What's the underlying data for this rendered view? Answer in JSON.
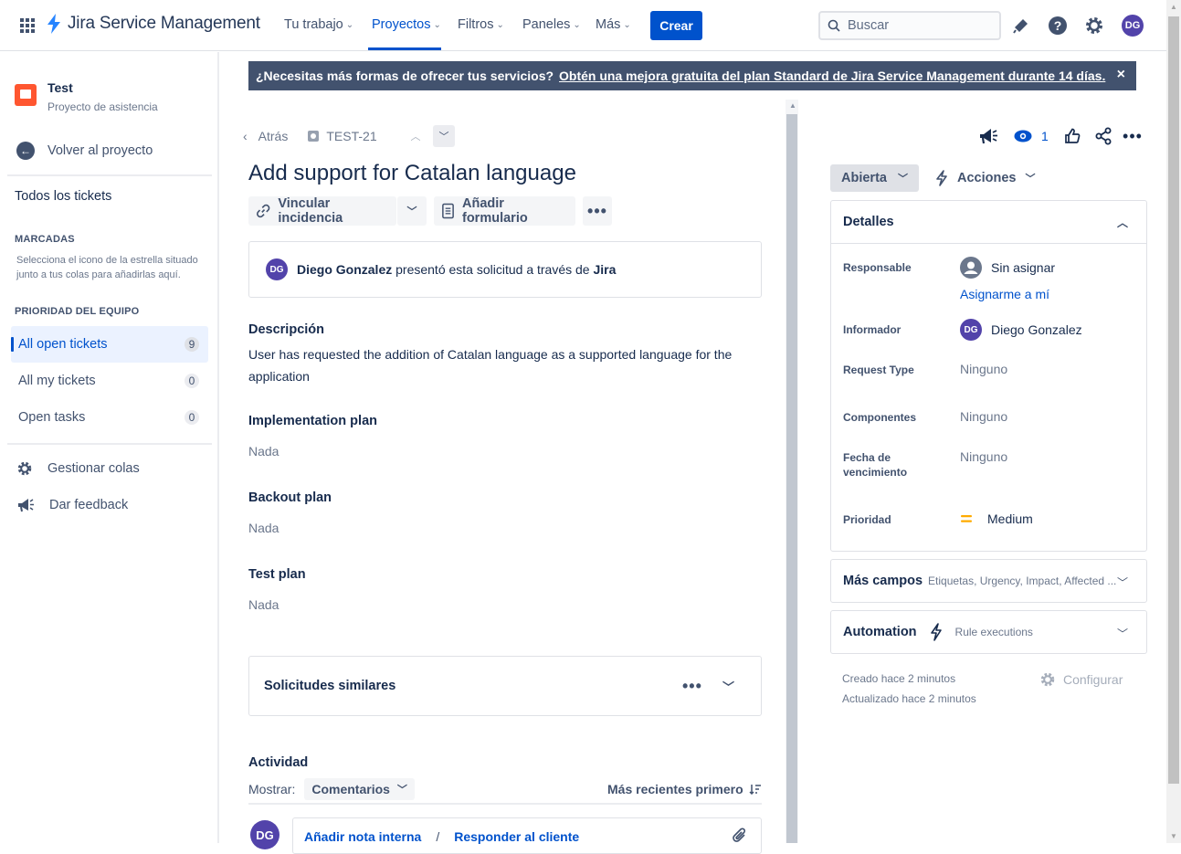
{
  "topnav": {
    "product": "Jira Service Management",
    "items": [
      {
        "label": "Tu trabajo"
      },
      {
        "label": "Proyectos"
      },
      {
        "label": "Filtros"
      },
      {
        "label": "Paneles"
      },
      {
        "label": "Más"
      }
    ],
    "create_label": "Crear",
    "search_placeholder": "Buscar",
    "avatar_initials": "DG",
    "accent": "#0052cc"
  },
  "sidebar": {
    "project_name": "Test",
    "project_type": "Proyecto de asistencia",
    "back_label": "Volver al proyecto",
    "all_tickets": "Todos los tickets",
    "starred_heading": "MARCADAS",
    "starred_note": "Selecciona el icono de la estrella situado junto a tus colas para añadirlas aquí.",
    "team_heading": "PRIORIDAD DEL EQUIPO",
    "queues": [
      {
        "label": "All open tickets",
        "count": "9"
      },
      {
        "label": "All my tickets",
        "count": "0"
      },
      {
        "label": "Open tasks",
        "count": "0"
      }
    ],
    "manage_queues": "Gestionar colas",
    "feedback": "Dar feedback"
  },
  "banner": {
    "text": "¿Necesitas más formas de ofrecer tus servicios?",
    "link": "Obtén una mejora gratuita del plan Standard de Jira Service Management durante 14 días.",
    "close": "×"
  },
  "issue": {
    "back_label": "Atrás",
    "key": "TEST-21",
    "title": "Add support for Catalan language",
    "link_issue": "Vincular incidencia",
    "add_form": "Añadir formulario",
    "reporter_initials": "DG",
    "reporter_name": "Diego Gonzalez",
    "created_via_text": "presentó esta solicitud a través de",
    "channel": "Jira",
    "description_label": "Descripción",
    "description": "User has requested the addition of Catalan language as a supported language for the application",
    "implementation_label": "Implementation plan",
    "implementation_value": "Nada",
    "backout_label": "Backout plan",
    "backout_value": "Nada",
    "test_label": "Test plan",
    "test_value": "Nada",
    "similar_label": "Solicitudes similares",
    "activity_label": "Actividad",
    "show_label": "Mostrar:",
    "show_value": "Comentarios",
    "sort_label": "Más recientes primero",
    "internal_note": "Añadir nota interna",
    "reply_customer": "Responder al cliente",
    "separator": "/"
  },
  "details_panel": {
    "watch_count": "1",
    "status": "Abierta",
    "actions": "Acciones",
    "heading": "Detalles",
    "assignee_label": "Responsable",
    "assignee_value": "Sin asignar",
    "assign_to_me": "Asignarme a mí",
    "reporter_label": "Informador",
    "reporter_value": "Diego Gonzalez",
    "request_type_label": "Request Type",
    "request_type_value": "Ninguno",
    "components_label": "Componentes",
    "components_value": "Ninguno",
    "due_date_label": "Fecha de vencimiento",
    "due_date_value": "Ninguno",
    "priority_label": "Prioridad",
    "priority_value": "Medium",
    "priority_color": "#ffab00",
    "more_fields": "Más campos",
    "more_fields_hint": "Etiquetas, Urgency, Impact, Affected ...",
    "automation": "Automation",
    "rule_executions": "Rule executions",
    "created": "Creado hace 2 minutos",
    "updated": "Actualizado hace 2 minutos",
    "configure": "Configurar"
  }
}
